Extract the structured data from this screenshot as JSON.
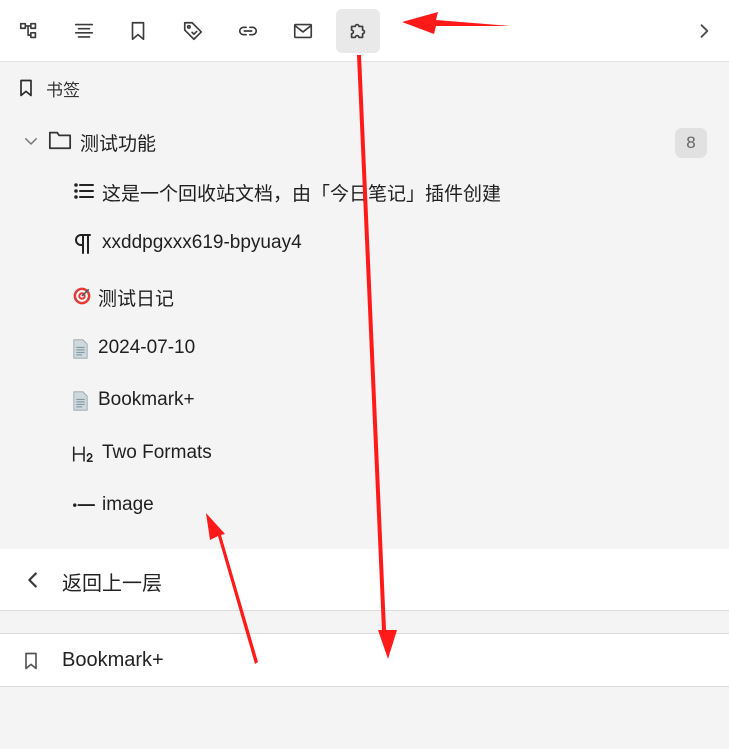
{
  "toolbar": {
    "buttons": [
      {
        "icon": "outline-tree-icon"
      },
      {
        "icon": "align-center-icon"
      },
      {
        "icon": "bookmark-icon"
      },
      {
        "icon": "tag-icon"
      },
      {
        "icon": "link-icon"
      },
      {
        "icon": "mail-icon"
      },
      {
        "icon": "puzzle-icon",
        "active": true
      }
    ],
    "more_icon": "chevron-right-icon"
  },
  "panel": {
    "title": "书签",
    "group": {
      "label": "测试功能",
      "count": "8",
      "expanded": true
    },
    "items": [
      {
        "icon": "list-icon",
        "label": "这是一个回收站文档，由「今日笔记」插件创建"
      },
      {
        "icon": "pilcrow-icon",
        "label": "xxddpgxxx619-bpyuay4"
      },
      {
        "icon": "target-emoji-icon",
        "label": "测试日记"
      },
      {
        "icon": "document-icon",
        "label": "2024-07-10"
      },
      {
        "icon": "document-icon",
        "label": "Bookmark+"
      },
      {
        "icon": "heading-2-icon",
        "label": "Two Formats"
      },
      {
        "icon": "list-item-icon",
        "label": "image"
      }
    ]
  },
  "footer": {
    "back_label": "返回上一层",
    "bookmark_label": "Bookmark+"
  },
  "colors": {
    "annotation_arrow": "#ff1a1a",
    "panel_bg": "#f4f4f4",
    "active_button_bg": "#e9e9e9"
  }
}
